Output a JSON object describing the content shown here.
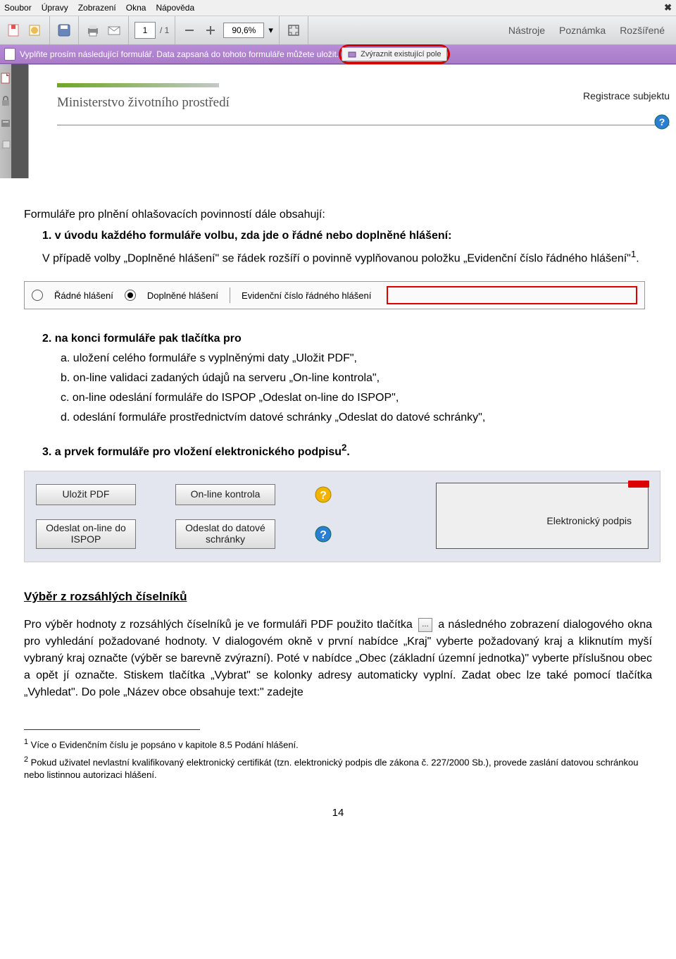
{
  "menubar": {
    "items": [
      "Soubor",
      "Úpravy",
      "Zobrazení",
      "Okna",
      "Nápověda"
    ]
  },
  "toolbar": {
    "page_current": "1",
    "page_total": "/ 1",
    "zoom": "90,6%",
    "right": [
      "Nástroje",
      "Poznámka",
      "Rozšířené"
    ]
  },
  "banner": {
    "text": "Vyplňte prosím následující formulář. Data zapsaná do tohoto formuláře můžete uložit.",
    "button": "Zvýraznit existující pole"
  },
  "docpage": {
    "ministry": "Ministerstvo životního prostředí",
    "reg_title": "Registrace subjektu"
  },
  "content": {
    "intro": "Formuláře pro plnění ohlašovacích povinností dále obsahují:",
    "li1_lead": "1. v úvodu každého formuláře volbu, zda jde o řádné nebo doplněné hlášení:",
    "li1_body_a": "V případě volby „Doplněné hlášení\" se řádek rozšíří o povinně vyplňovanou položku „Evidenční číslo řádného hlášení\"",
    "sup1": "1",
    "dot": ".",
    "radio": {
      "r1": "Řádné hlášení",
      "r2": "Doplněné hlášení",
      "r3": "Evidenční číslo řádného hlášení"
    },
    "li2": "2. na konci formuláře pak tlačítka pro",
    "li2a": "a. uložení celého formuláře s vyplněnými daty „Uložit PDF\",",
    "li2b": "b. on-line validaci zadaných údajů na serveru „On-line kontrola\",",
    "li2c": "c. on-line odeslání formuláře do ISPOP „Odeslat on-line do ISPOP\",",
    "li2d": "d. odeslání formuláře prostřednictvím datové schránky „Odeslat do datové schránky\",",
    "li3_a": "3. a prvek formuláře pro vložení elektronického podpisu",
    "sup2": "2",
    "buttons": {
      "b1": "Uložit PDF",
      "b2": "On-line kontrola",
      "b3": "Odeslat on-line do ISPOP",
      "b4": "Odeslat do datové schránky",
      "sig": "Elektronický podpis"
    },
    "section": "Výběr z rozsáhlých číselníků",
    "para1a": "Pro výběr hodnoty z rozsáhlých číselníků je ve formuláři PDF použito tlačítka",
    "para1b": "a následného zobrazení dialogového okna pro vyhledání požadované hodnoty. V dialogovém okně v první nabídce „Kraj\" vyberte požadovaný kraj a kliknutím myší vybraný kraj označte (výběr se barevně zvýrazní). Poté v nabídce „Obec (základní územní jednotka)\" vyberte příslušnou obec a opět jí označte. Stiskem tlačítka „Vybrat\" se kolonky adresy automaticky vyplní. Zadat obec lze také pomocí tlačítka „Vyhledat\". Do pole „Název obce obsahuje text:\" zadejte",
    "fn1_sup": "1",
    "fn1": " Více o Evidenčním číslu je popsáno v kapitole 8.5 Podání hlášení.",
    "fn2_sup": "2",
    "fn2": " Pokud uživatel nevlastní kvalifikovaný elektronický certifikát (tzn. elektronický podpis dle zákona č. 227/2000 Sb.), provede zaslání datovou schránkou nebo listinnou autorizaci hlášení.",
    "pagenum": "14"
  }
}
